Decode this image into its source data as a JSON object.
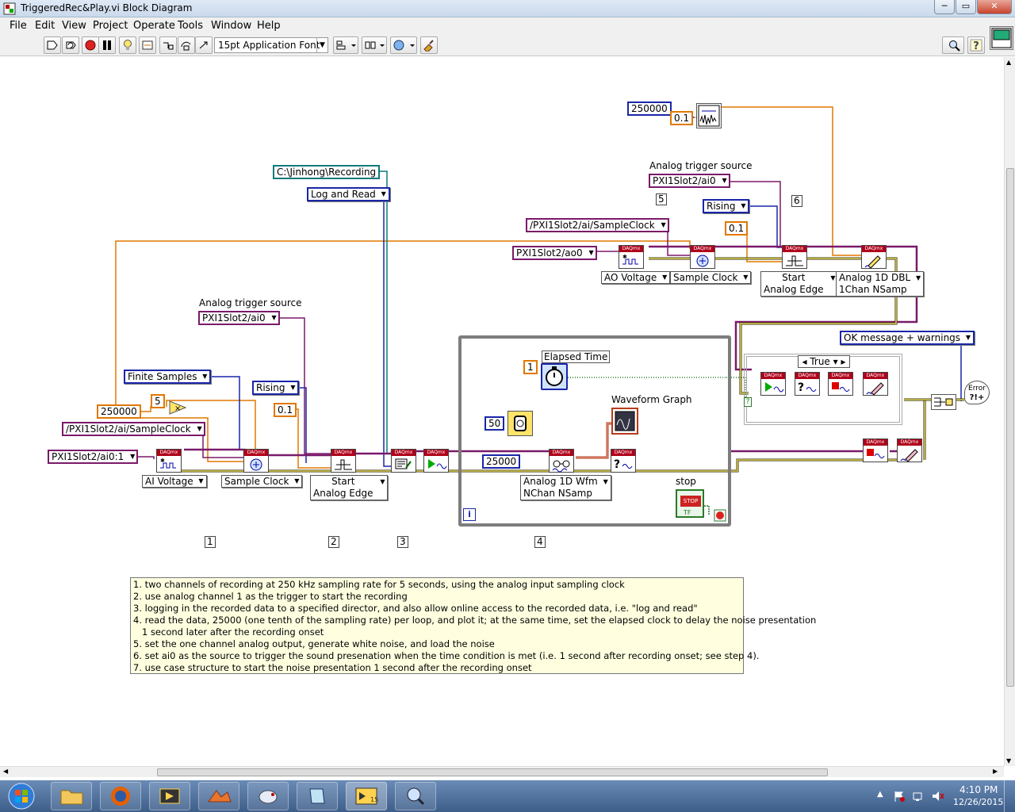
{
  "window": {
    "title": "TriggeredRec&Play.vi Block Diagram"
  },
  "menu": [
    "File",
    "Edit",
    "View",
    "Project",
    "Operate",
    "Tools",
    "Window",
    "Help"
  ],
  "toolbar": {
    "font": "15pt Application Font"
  },
  "diagram": {
    "path_const": "C:\\Jinhong\\Recording",
    "log_mode": "Log and Read",
    "finite_samples": "Finite Samples",
    "num_250000_a": "250000",
    "num_5": "5",
    "ai_clock": "/PXI1Slot2/ai/SampleClock",
    "ai_chan": "PXI1Slot2/ai0:1",
    "trig_label_a": "Analog trigger source",
    "trig_src_a": "PXI1Slot2/ai0",
    "rising_a": "Rising",
    "level_a": "0.1",
    "ai_voltage": "AI Voltage",
    "sample_clock_a": "Sample Clock",
    "start_edge_a_1": "Start",
    "start_edge_a_2": "Analog Edge",
    "num_250000_b": "250000",
    "num_01_noise": "0.1",
    "trig_label_b": "Analog trigger source",
    "trig_src_b": "PXI1Slot2/ai0",
    "rising_b": "Rising",
    "level_b": "0.1",
    "ao_clock": "/PXI1Slot2/ai/SampleClock",
    "ao_chan": "PXI1Slot2/ao0",
    "ao_voltage": "AO Voltage",
    "sample_clock_b": "Sample Clock",
    "start_edge_b_1": "Start",
    "start_edge_b_2": "Analog Edge",
    "write_mode_1": "Analog 1D DBL",
    "write_mode_2": "1Chan NSamp",
    "elapsed_label": "Elapsed Time",
    "elapsed_num": "1",
    "wait_num": "50",
    "waveform_label": "Waveform Graph",
    "read_num": "25000",
    "read_mode_1": "Analog 1D Wfm",
    "read_mode_2": "NChan NSamp",
    "stop_label": "stop",
    "stop_btn": "STOP",
    "loop_iter": "i",
    "case_sel": "True",
    "ok_msg": "OK message + warnings",
    "error_ico": "Error",
    "step_1": "1",
    "step_2": "2",
    "step_3": "3",
    "step_4": "4",
    "step_5": "5",
    "step_6": "6"
  },
  "comment": [
    "1. two channels of recording at 250 kHz sampling rate for 5 seconds, using the analog input sampling clock",
    "2. use analog channel 1 as the trigger to start the recording",
    "3. logging in the recorded data to a specified director, and also allow online access to the recorded data, i.e. \"log and read\"",
    "4. read the data, 25000 (one tenth of the sampling rate) per loop, and plot it; at the same time, set the elapsed clock to delay the noise presentation",
    "   1 second later after the recording onset",
    "5. set the one channel analog output, generate white noise, and load the noise",
    "6. set ai0 as the source to trigger the sound presenation when the time condition is met (i.e. 1 second after recording onset; see step 4).",
    "7. use case structure to start the noise presentation 1 second after the recording onset"
  ],
  "taskbar": {
    "time": "4:10 PM",
    "date": "12/26/2015"
  }
}
